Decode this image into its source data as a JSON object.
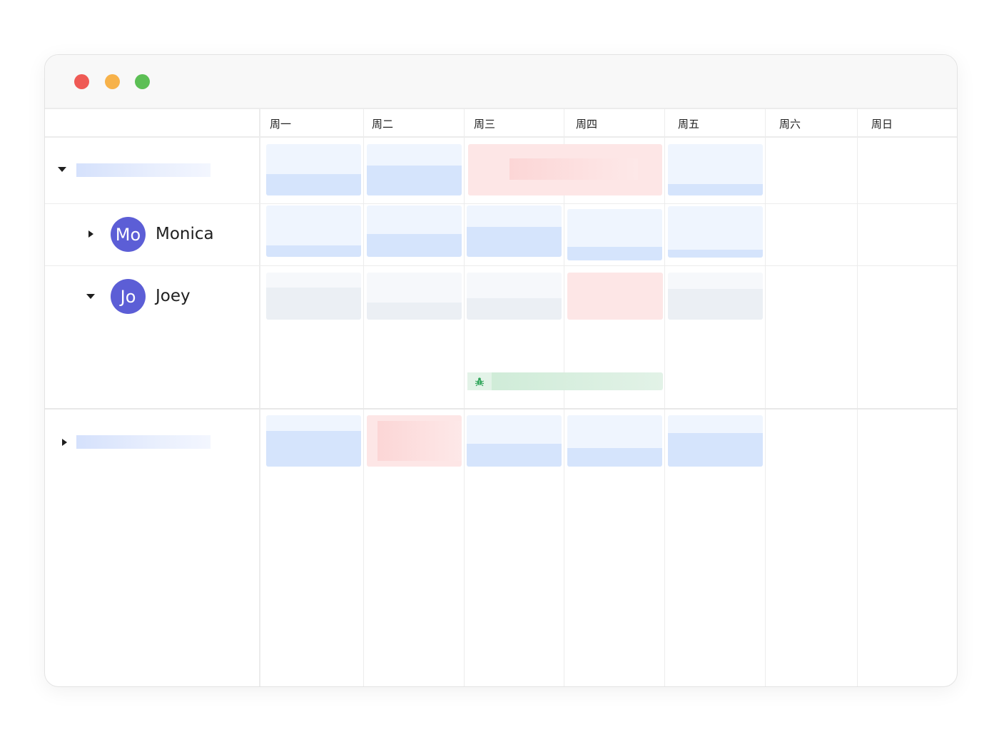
{
  "window": {
    "controls": [
      "close",
      "minimize",
      "maximize"
    ]
  },
  "week": {
    "days": [
      "周一",
      "周二",
      "周三",
      "周四",
      "周五",
      "周六",
      "周日"
    ]
  },
  "people": [
    {
      "avatar": "Mo",
      "name": "Monica"
    },
    {
      "avatar": "Jo",
      "name": "Joey"
    }
  ],
  "icons": {
    "task_type": "bug-icon"
  },
  "colors": {
    "avatar": "#5c5ed6",
    "task_blue": "#d5e4fc",
    "task_red": "#fde6e6",
    "task_green": "#cdebd6",
    "bug_icon": "#2fa55a"
  }
}
